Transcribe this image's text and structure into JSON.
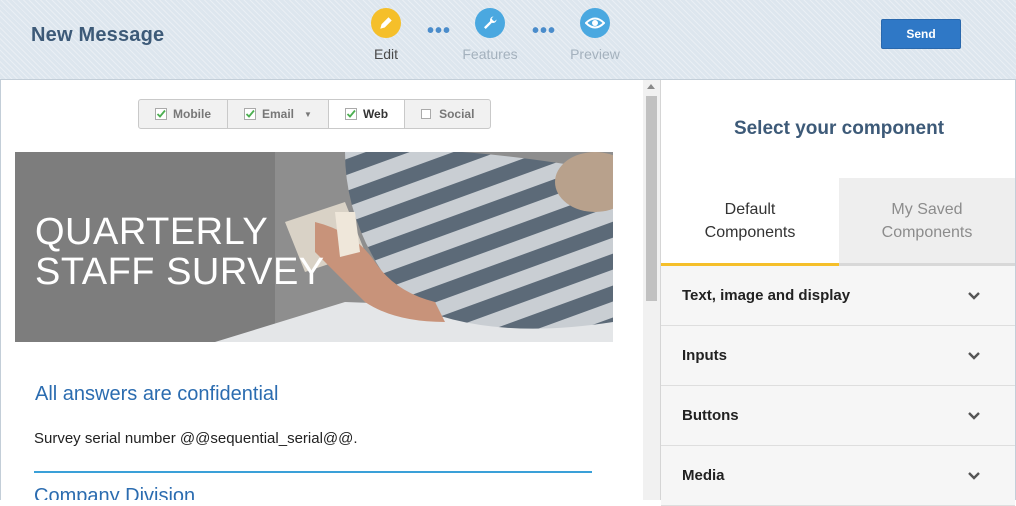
{
  "header": {
    "title": "New Message",
    "steps": [
      {
        "label": "Edit",
        "icon": "pencil-icon",
        "state": "active"
      },
      {
        "label": "Features",
        "icon": "wrench-icon",
        "state": "inactive"
      },
      {
        "label": "Preview",
        "icon": "eye-icon",
        "state": "inactive"
      }
    ],
    "separator": "•••",
    "send_label": "Send"
  },
  "channels": [
    {
      "label": "Mobile",
      "checked": true
    },
    {
      "label": "Email",
      "checked": true,
      "has_dropdown": true
    },
    {
      "label": "Web",
      "checked": true,
      "active": true
    },
    {
      "label": "Social",
      "checked": false
    }
  ],
  "message": {
    "hero_title_line1": "QUARTERLY",
    "hero_title_line2": "STAFF SURVEY",
    "section_heading": "All answers are confidential",
    "serial_text": "Survey serial number @@sequential_serial@@.",
    "next_heading": "Company Division"
  },
  "panel": {
    "title": "Select your component",
    "tabs": [
      {
        "line1": "Default",
        "line2": "Components",
        "active": true
      },
      {
        "line1": "My Saved",
        "line2": "Components",
        "active": false
      }
    ],
    "accordion": [
      {
        "label": "Text, image and display"
      },
      {
        "label": "Inputs"
      },
      {
        "label": "Buttons"
      },
      {
        "label": "Media"
      }
    ]
  },
  "colors": {
    "accent_yellow": "#f5bf2a",
    "accent_blue": "#2f78c6",
    "heading_blue": "#2b6cb0",
    "title_navy": "#3d5a78"
  }
}
